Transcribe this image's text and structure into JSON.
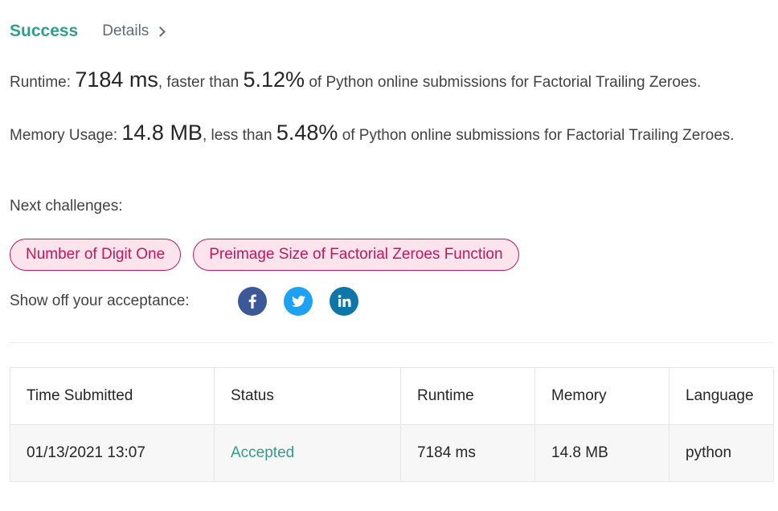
{
  "header": {
    "status": "Success",
    "details_label": "Details"
  },
  "runtime": {
    "label": "Runtime:",
    "value": "7184 ms",
    "mid": ", faster than",
    "percent": "5.12%",
    "suffix": "of Python online submissions for Factorial Trailing Zeroes."
  },
  "memory": {
    "label": "Memory Usage:",
    "value": "14.8 MB",
    "mid": ", less than",
    "percent": "5.48%",
    "suffix": "of Python online submissions for Factorial Trailing Zeroes."
  },
  "next": {
    "label": "Next challenges:",
    "challenges": [
      "Number of Digit One",
      "Preimage Size of Factorial Zeroes Function"
    ]
  },
  "share": {
    "label": "Show off your acceptance:",
    "icons": [
      "facebook-icon",
      "twitter-icon",
      "linkedin-icon"
    ]
  },
  "table": {
    "headers": [
      "Time Submitted",
      "Status",
      "Runtime",
      "Memory",
      "Language"
    ],
    "rows": [
      [
        "01/13/2021 13:07",
        "Accepted",
        "7184 ms",
        "14.8 MB",
        "python"
      ]
    ]
  },
  "colors": {
    "success": "#2f9e8a",
    "chip_border": "#c2185b",
    "chip_bg": "#fde4ec",
    "facebook": "#3b5998",
    "twitter": "#1da1f2",
    "linkedin": "#0e76a8"
  }
}
